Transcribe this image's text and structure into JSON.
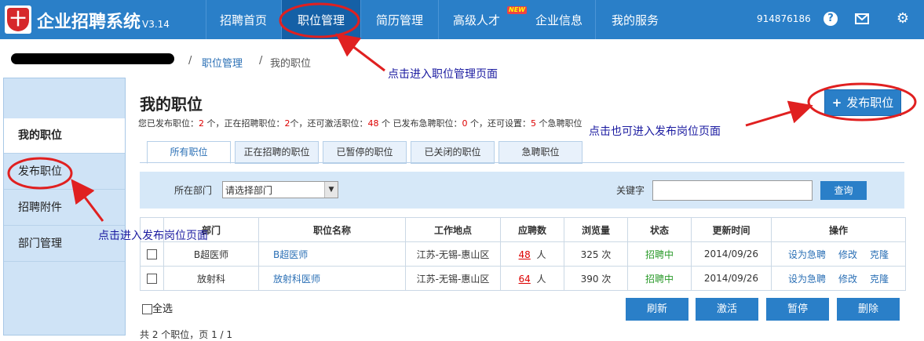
{
  "brand": {
    "name": "企业招聘系统",
    "version": "V3.14",
    "logo_mark": "十"
  },
  "nav": {
    "items": [
      {
        "label": "招聘首页"
      },
      {
        "label": "职位管理"
      },
      {
        "label": "简历管理"
      },
      {
        "label": "高级人才"
      },
      {
        "label": "企业信息"
      },
      {
        "label": "我的服务"
      }
    ],
    "new_badge": "NEW",
    "active_index": 1
  },
  "account": {
    "id": "914876186"
  },
  "icons": {
    "help": "help-icon",
    "mail": "mail-icon",
    "settings": "gear-icon"
  },
  "breadcrumb": {
    "items": [
      "职位管理",
      "我的职位"
    ],
    "sep": "/"
  },
  "sidebar": {
    "items": [
      {
        "label": "我的职位"
      },
      {
        "label": "发布职位"
      },
      {
        "label": "招聘附件"
      },
      {
        "label": "部门管理"
      }
    ],
    "active_index": 0
  },
  "main": {
    "title": "我的职位",
    "stats": {
      "t1": "您已发布职位：",
      "published": "2",
      "t2": " 个，正在招聘职位：",
      "recruiting": "2",
      "t3": "个，还可激活职位：",
      "activatable": "48",
      "t4": " 个  已发布急聘职位：",
      "urgent": "0",
      "t5": " 个，还可设置：",
      "settable": "5",
      "t6": " 个急聘职位"
    },
    "publish_button": {
      "plus": "+",
      "label": "发布职位"
    }
  },
  "tabs": [
    "所有职位",
    "正在招聘的职位",
    "已暂停的职位",
    "已关闭的职位",
    "急聘职位"
  ],
  "filter": {
    "dept_label": "所在部门",
    "dept_value": "请选择部门",
    "keyword_label": "关键字",
    "keyword_value": "",
    "query_button": "查询"
  },
  "table": {
    "headers": [
      "部门",
      "职位名称",
      "工作地点",
      "应聘数",
      "浏览量",
      "状态",
      "更新时间",
      "操作"
    ],
    "rows": [
      {
        "dept": "B超医师",
        "name": "B超医师",
        "location": "江苏-无锡-惠山区",
        "applicants": "48",
        "applicants_unit": "人",
        "views": "325 次",
        "status": "招聘中",
        "updated": "2014/09/26",
        "ops": [
          "设为急聘",
          "修改",
          "克隆"
        ]
      },
      {
        "dept": "放射科",
        "name": "放射科医师",
        "location": "江苏-无锡-惠山区",
        "applicants": "64",
        "applicants_unit": "人",
        "views": "390 次",
        "status": "招聘中",
        "updated": "2014/09/26",
        "ops": [
          "设为急聘",
          "修改",
          "克隆"
        ]
      }
    ]
  },
  "bulk": {
    "select_all": "全选",
    "buttons": [
      "刷新",
      "激活",
      "暂停",
      "删除"
    ]
  },
  "pager": {
    "text": "共 2 个职位，页 1 / 1"
  },
  "annotations": {
    "nav": "点击进入职位管理页面",
    "publish": "点击也可进入发布岗位页面",
    "sidebar": "点击进入发布岗位页面"
  },
  "colors": {
    "primary": "#2a7fc8",
    "annotation": "#1a1aa0",
    "arrow": "#e02020"
  }
}
